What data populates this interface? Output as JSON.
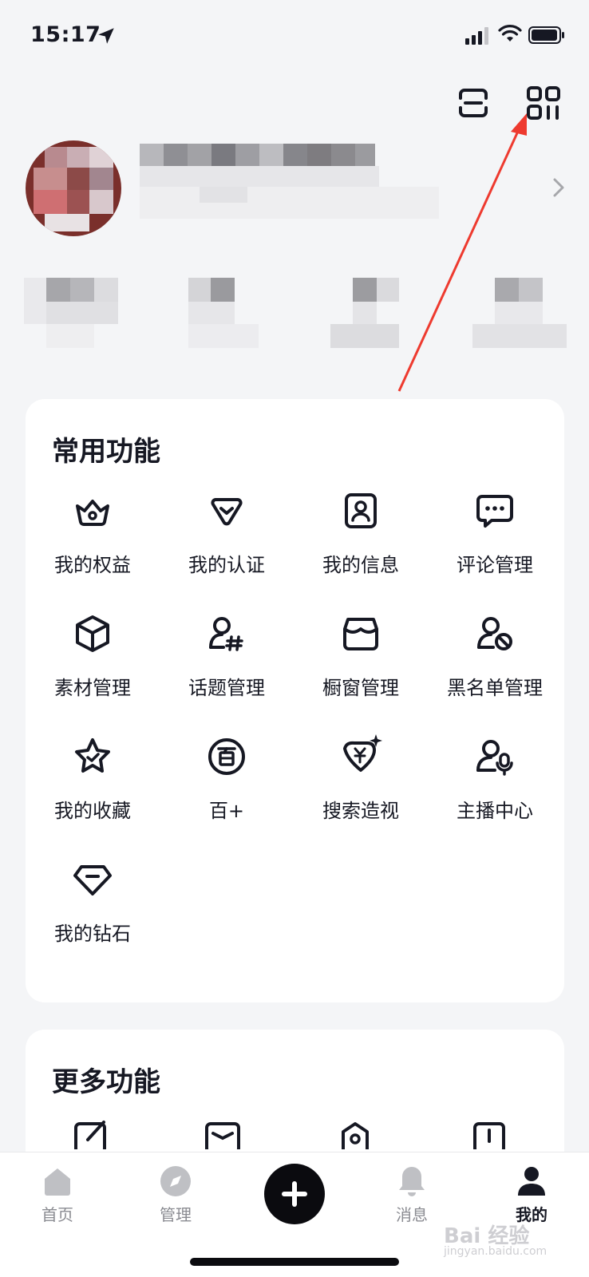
{
  "status_bar": {
    "time": "15:17"
  },
  "sections": {
    "common_title": "常用功能",
    "more_title": "更多功能"
  },
  "common_features": [
    {
      "label": "我的权益",
      "icon": "crown-icon"
    },
    {
      "label": "我的认证",
      "icon": "verified-badge-icon"
    },
    {
      "label": "我的信息",
      "icon": "profile-card-icon"
    },
    {
      "label": "评论管理",
      "icon": "comment-icon"
    },
    {
      "label": "素材管理",
      "icon": "cube-icon"
    },
    {
      "label": "话题管理",
      "icon": "topic-user-hash-icon"
    },
    {
      "label": "橱窗管理",
      "icon": "storefront-icon"
    },
    {
      "label": "黑名单管理",
      "icon": "block-user-icon"
    },
    {
      "label": "我的收藏",
      "icon": "star-icon"
    },
    {
      "label": "百+",
      "icon": "bai-plus-icon"
    },
    {
      "label": "搜索造视",
      "icon": "yen-heart-sparkle-icon"
    },
    {
      "label": "主播中心",
      "icon": "anchor-mic-icon"
    },
    {
      "label": "我的钻石",
      "icon": "diamond-icon"
    }
  ],
  "bottom_nav": [
    {
      "label": "首页",
      "icon": "home-icon",
      "active": false
    },
    {
      "label": "管理",
      "icon": "compass-icon",
      "active": false
    },
    {
      "label": "",
      "icon": "plus-icon",
      "active": false
    },
    {
      "label": "消息",
      "icon": "bell-icon",
      "active": false
    },
    {
      "label": "我的",
      "icon": "person-icon",
      "active": true
    }
  ],
  "watermark": {
    "text": "Bai 经验",
    "sub": "jingyan.baidu.com"
  },
  "colors": {
    "background": "#f4f5f7",
    "card": "#ffffff",
    "text": "#161823",
    "nav_inactive": "#8a8b91",
    "annotation": "#ee3a2f"
  }
}
